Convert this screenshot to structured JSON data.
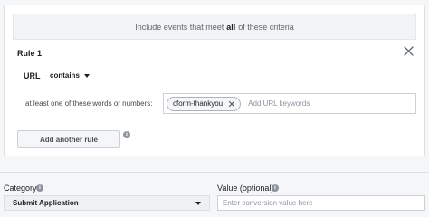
{
  "criteria": {
    "prefix": "Include events that meet",
    "emphasis": "all",
    "suffix": "of these criteria"
  },
  "rule": {
    "title": "Rule 1",
    "parameter_label": "URL",
    "operator": "contains",
    "match_label": "at least one of these words or numbers:",
    "keywords": [
      "cform-thankyou"
    ],
    "keyword_placeholder": "Add URL keywords",
    "add_rule_label": "Add another rule"
  },
  "category": {
    "label": "Category",
    "selected": "Submit Application"
  },
  "value": {
    "label": "Value (optional)",
    "value": "",
    "placeholder": "Enter conversion value here"
  },
  "icons": {
    "close": "close-icon",
    "dropdown": "caret-down-icon",
    "chip_remove": "x-icon",
    "info": "info-icon"
  }
}
